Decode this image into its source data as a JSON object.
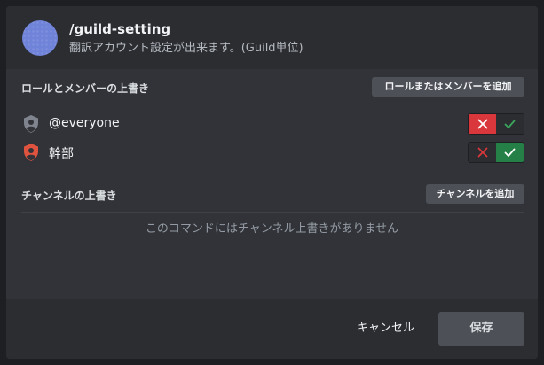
{
  "command": {
    "title": "/guild-setting",
    "description": "翻訳アカウント設定が出来ます。(Guild単位)"
  },
  "roles_section": {
    "label": "ロールとメンバーの上書き",
    "add_button_label": "ロールまたはメンバーを追加",
    "rows": [
      {
        "label": "@everyone",
        "icon": "everyone-shield-icon",
        "state": "deny"
      },
      {
        "label": "幹部",
        "icon": "role-shield-icon",
        "state": "allow"
      }
    ]
  },
  "channels_section": {
    "label": "チャンネルの上書き",
    "add_button_label": "チャンネルを追加",
    "empty_text": "このコマンドにはチャンネル上書きがありません"
  },
  "footer": {
    "cancel_label": "キャンセル",
    "save_label": "保存"
  },
  "colors": {
    "deny_active": "#da373c",
    "allow_active": "#248046",
    "role_icon": "#e0533e"
  }
}
